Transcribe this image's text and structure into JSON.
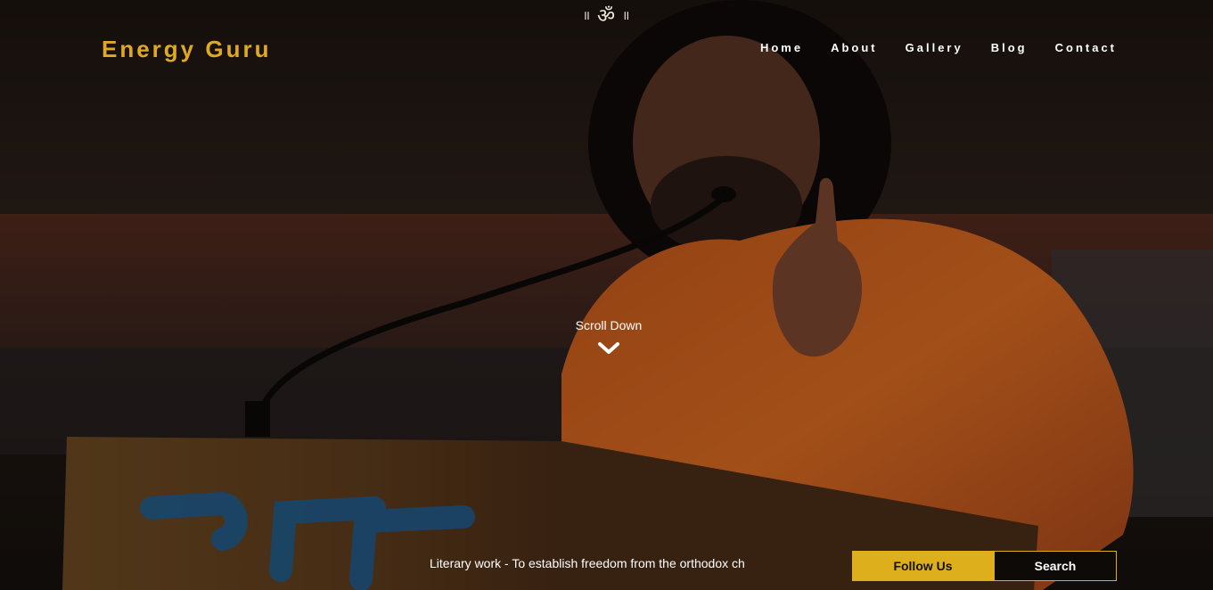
{
  "header": {
    "om_left": "॥",
    "om_symbol": "ॐ",
    "om_right": "॥",
    "brand": "Energy Guru",
    "nav": [
      "Home",
      "About",
      "Gallery",
      "Blog",
      "Contact"
    ]
  },
  "hero": {
    "scroll_label": "Scroll Down",
    "scroll_icon": "chevron-down-icon"
  },
  "footer_bar": {
    "ticker_text": "Literary work - To establish freedom from the orthodox ch",
    "follow_label": "Follow Us",
    "search_label": "Search"
  },
  "colors": {
    "brand_gold": "#e0a922",
    "button_gold": "#deaf1d",
    "robe_orange": "#d9691f"
  }
}
